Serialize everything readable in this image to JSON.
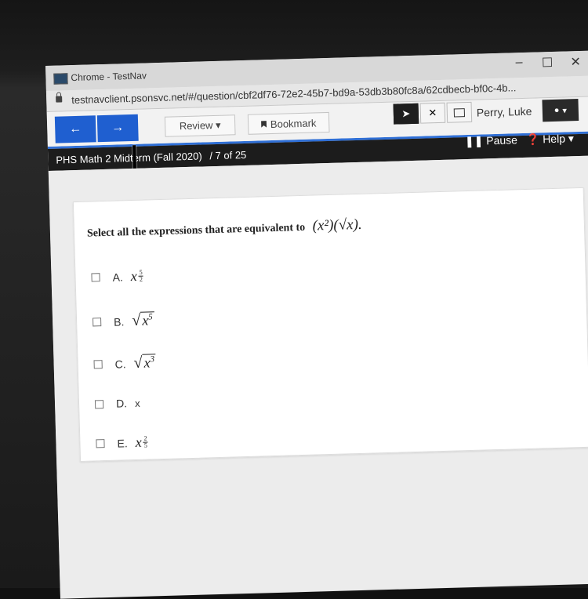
{
  "window": {
    "title": "Chrome - TestNav",
    "controls": [
      "–",
      "☐",
      "✕"
    ]
  },
  "url": "testnavclient.psonsvc.net/#/question/cbf2df76-72e2-45b7-bd9a-53db3b80fc8a/62cdbecb-bf0c-4b...",
  "toolbar": {
    "back_label": "←",
    "forward_label": "→",
    "review_label": "Review ▾",
    "bookmark_label": "Bookmark",
    "user_name": "Perry, Luke",
    "user_menu_label": "▾"
  },
  "testbar": {
    "title": "PHS Math 2 Midterm (Fall 2020)",
    "progress": "/ 7 of 25",
    "pause_label": "Pause",
    "help_label": "Help ▾"
  },
  "question": {
    "prompt": "Select all the expressions that are equivalent to",
    "expression": "(x²)(√x).",
    "options": [
      {
        "letter": "A.",
        "base": "x",
        "num": "5",
        "den": "2"
      },
      {
        "letter": "B.",
        "radicand": "x",
        "power": "5"
      },
      {
        "letter": "C.",
        "radicand": "x",
        "power": "3"
      },
      {
        "letter": "D.",
        "text": "x"
      },
      {
        "letter": "E.",
        "base": "x",
        "num": "2",
        "den": "5"
      }
    ]
  }
}
